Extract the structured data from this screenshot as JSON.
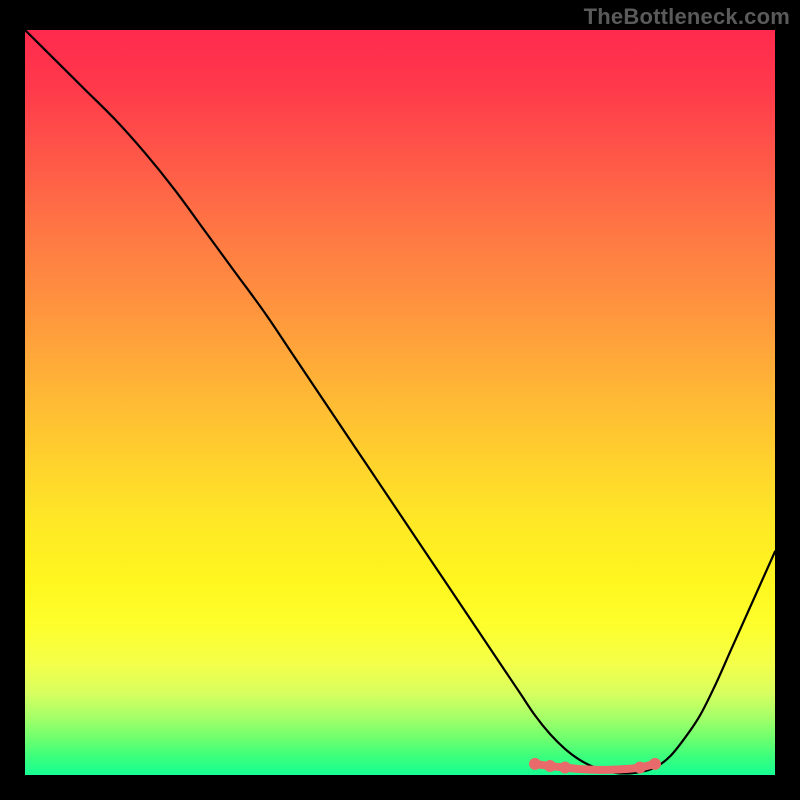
{
  "watermark": "TheBottleneck.com",
  "colors": {
    "curve": "#000000",
    "accent": "#e86a6a",
    "frame": "#000000"
  },
  "chart_data": {
    "type": "line",
    "title": "",
    "xlabel": "",
    "ylabel": "",
    "xlim": [
      0,
      100
    ],
    "ylim": [
      0,
      100
    ],
    "grid": false,
    "legend": false,
    "series": [
      {
        "name": "bottleneck_curve",
        "x": [
          0,
          4,
          8,
          12,
          16,
          20,
          24,
          28,
          32,
          36,
          40,
          44,
          48,
          52,
          56,
          60,
          64,
          66,
          68,
          70,
          72,
          74,
          76,
          78,
          80,
          82,
          84,
          86,
          88,
          90,
          92,
          94,
          96,
          98,
          100
        ],
        "y": [
          100,
          96,
          92,
          88,
          83.5,
          78.5,
          73,
          67.5,
          62,
          56,
          50,
          44,
          38,
          32,
          26,
          20,
          14,
          11,
          8,
          5.5,
          3.5,
          2,
          1,
          0.4,
          0.2,
          0.4,
          1,
          2.5,
          5,
          8,
          12,
          16.5,
          21,
          25.5,
          30
        ]
      }
    ],
    "optimal_range": {
      "x": [
        68,
        70,
        72,
        74,
        76,
        78,
        80,
        82,
        84
      ],
      "y": [
        1.5,
        1.2,
        1.0,
        0.8,
        0.7,
        0.7,
        0.8,
        1.0,
        1.5
      ]
    }
  }
}
